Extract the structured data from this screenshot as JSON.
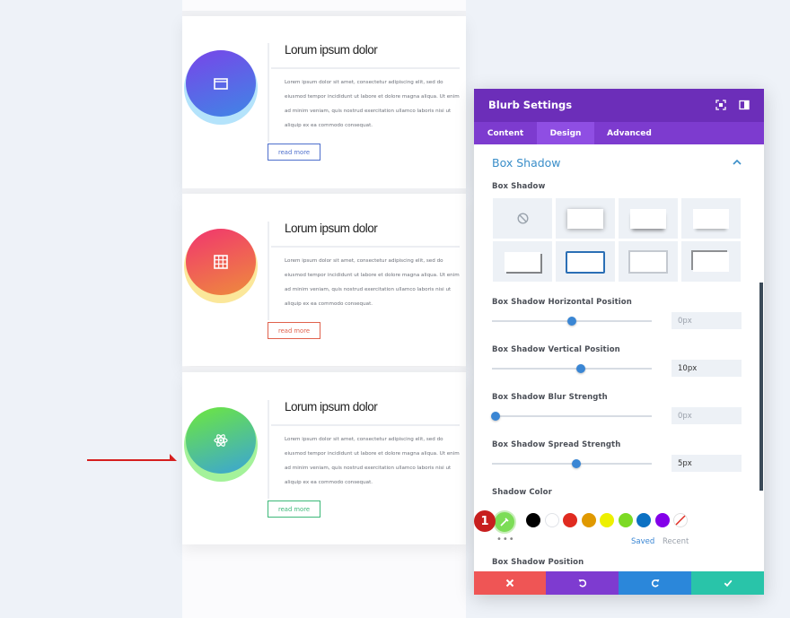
{
  "blurbs": [
    {
      "title": "Lorum ipsum dolor",
      "body": "Lorem ipsum dolor sit amet, consectetur adipiscing elit, sed do eiusmod tempor incididunt ut labore et dolore magna aliqua. Ut enim ad minim veniam, quis nostrud exercitation ullamco laboris nisi ut aliquip ex ea commodo consequat.",
      "button": "read more",
      "icon": "folder-icon",
      "accent": "#4e6fcc"
    },
    {
      "title": "Lorum ipsum dolor",
      "body": "Lorem ipsum dolor sit amet, consectetur adipiscing elit, sed do eiusmod tempor incididunt ut labore et dolore magna aliqua. Ut enim ad minim veniam, quis nostrud exercitation ullamco laboris nisi ut aliquip ex ea commodo consequat.",
      "button": "read more",
      "icon": "table-icon",
      "accent": "#e0624d"
    },
    {
      "title": "Lorum ipsum dolor",
      "body": "Lorem ipsum dolor sit amet, consectetur adipiscing elit, sed do eiusmod tempor incididunt ut labore et dolore magna aliqua. Ut enim ad minim veniam, quis nostrud exercitation ullamco laboris nisi ut aliquip ex ea commodo consequat.",
      "button": "read more",
      "icon": "atom-icon",
      "accent": "#3cb878"
    }
  ],
  "modal": {
    "title": "Blurb Settings",
    "tabs": [
      "Content",
      "Design",
      "Advanced"
    ],
    "active_tab": "Design",
    "section_title": "Box Shadow",
    "box_shadow_label": "Box Shadow",
    "selected_preset": 6,
    "fields": [
      {
        "label": "Box Shadow Horizontal Position",
        "value": "0px",
        "placeholder": true,
        "slider": 0.5
      },
      {
        "label": "Box Shadow Vertical Position",
        "value": "10px",
        "placeholder": false,
        "slider": 0.55
      },
      {
        "label": "Box Shadow Blur Strength",
        "value": "0px",
        "placeholder": true,
        "slider": 0.0
      },
      {
        "label": "Box Shadow Spread Strength",
        "value": "5px",
        "placeholder": false,
        "slider": 0.53
      }
    ],
    "shadow_color_label": "Shadow Color",
    "selected_color": "#7cdd56",
    "palette": [
      "#000000",
      "#ffffff",
      "#e02b20",
      "#e09900",
      "#edf000",
      "#7cda24",
      "#0c71c3",
      "#8300e9"
    ],
    "saved_label": "Saved",
    "recent_label": "Recent",
    "position_label": "Box Shadow Position",
    "badge": "1"
  },
  "colors": {
    "header": "#6c2eb9",
    "tabs": "#7d3bcf",
    "link": "#3a8ec9",
    "cancel": "#ef5555",
    "undo": "#7e3bd0",
    "redo": "#2b87da",
    "save": "#29c4a9",
    "arrow": "#d61f1f"
  }
}
